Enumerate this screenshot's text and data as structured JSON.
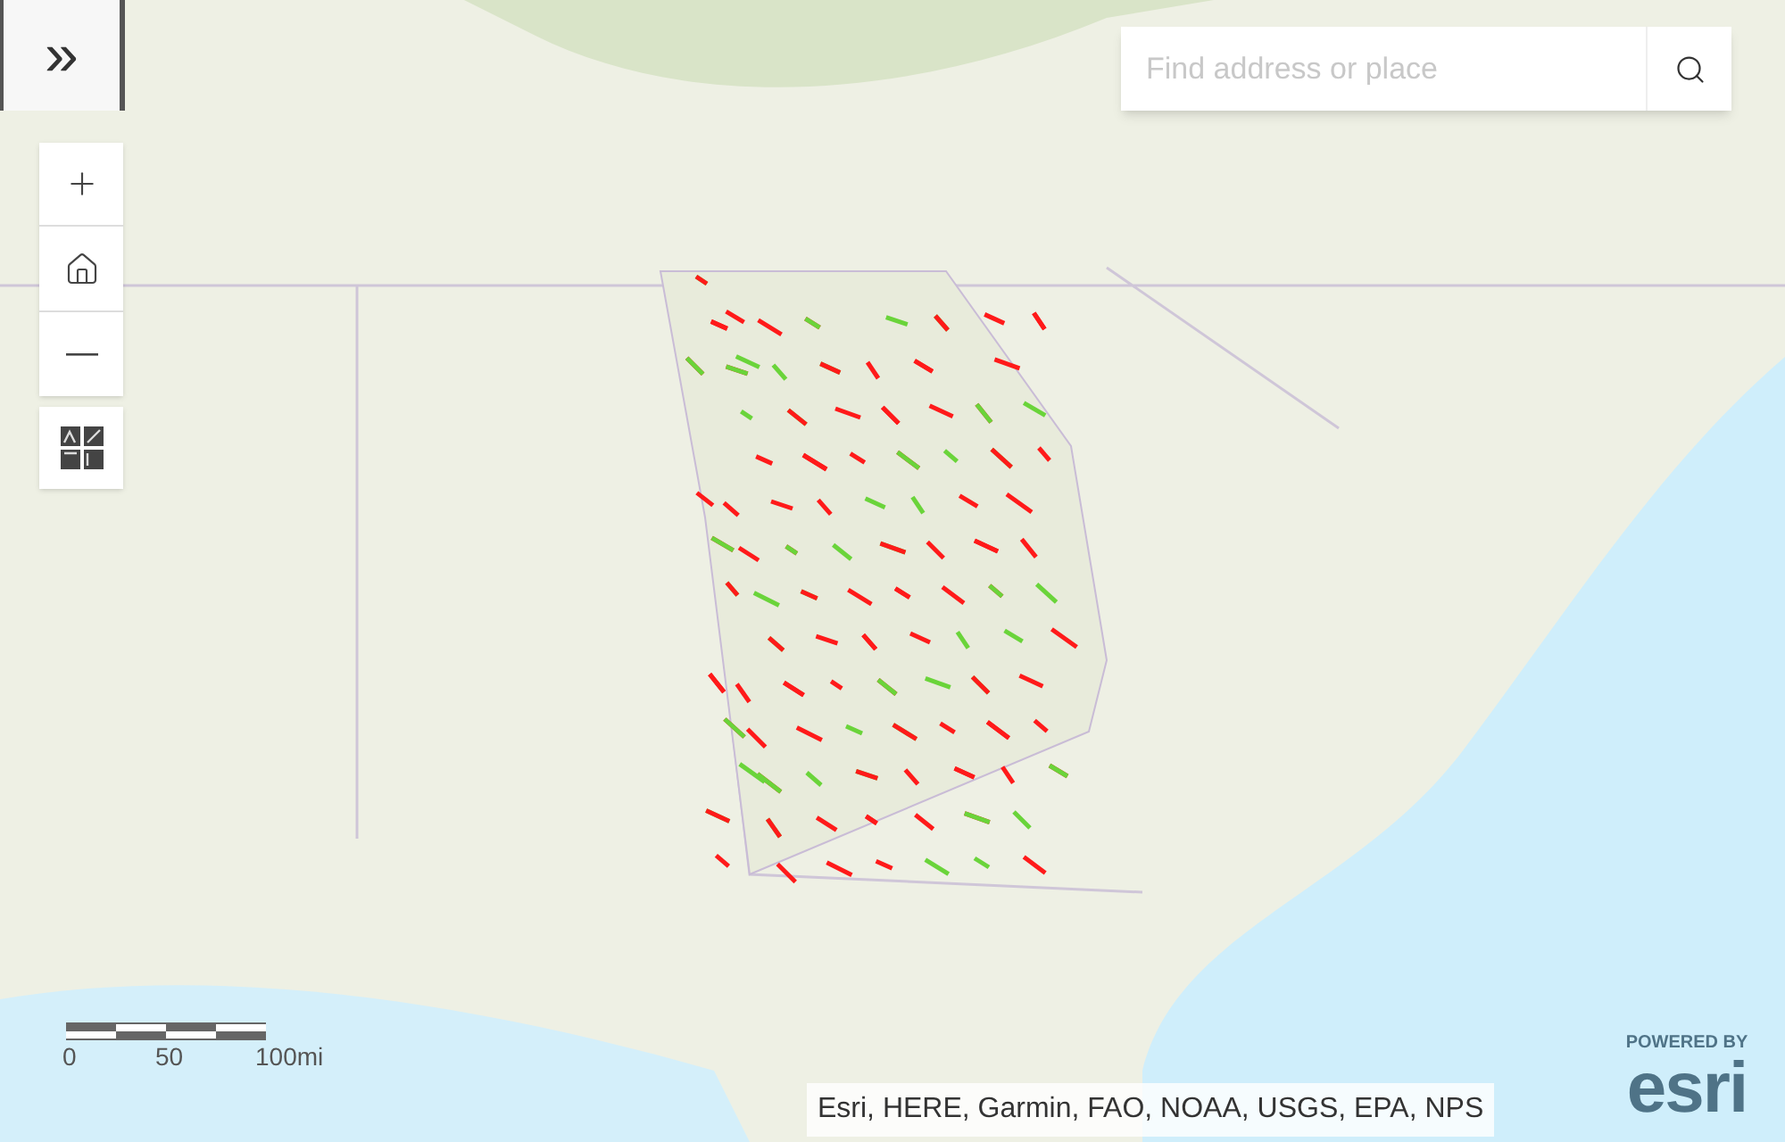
{
  "search": {
    "placeholder": "Find address or place"
  },
  "expand_button": {
    "label": "»"
  },
  "scale_bar": {
    "labels": [
      "0",
      "50",
      "100mi"
    ]
  },
  "attribution": "Esri, HERE, Garmin, FAO, NOAA, USGS, EPA, NPS",
  "logo": {
    "tagline": "POWERED BY",
    "name": "esri"
  }
}
